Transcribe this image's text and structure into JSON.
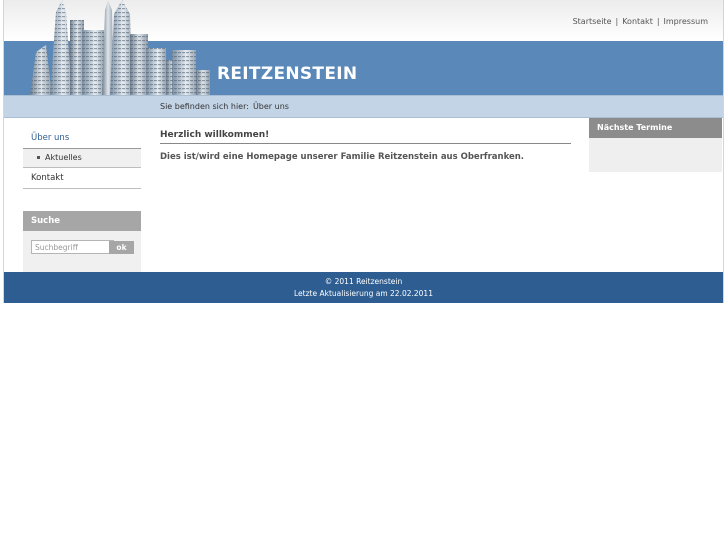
{
  "header": {
    "links": [
      "Startseite",
      "Kontakt",
      "Impressum"
    ],
    "separator": "|",
    "site_title": "REITZENSTEIN"
  },
  "breadcrumb": {
    "label": "Sie befinden sich hier:",
    "current": "Über uns"
  },
  "sidebar": {
    "items": [
      {
        "label": "Über uns"
      },
      {
        "label": "Aktuelles"
      },
      {
        "label": "Kontakt"
      }
    ]
  },
  "search": {
    "title": "Suche",
    "placeholder": "Suchbegriff",
    "button": "ok"
  },
  "main": {
    "title": "Herzlich willkommen!",
    "text": "Dies ist/wird eine Homepage unserer Familie Reitzenstein aus Oberfranken."
  },
  "termine": {
    "title": "Nächste Termine"
  },
  "footer": {
    "copyright": "© 2011 Reitzenstein",
    "updated": "Letzte Aktualisierung am 22.02.2011"
  },
  "colors": {
    "banner": "#5a88b8",
    "footer": "#2d5d91",
    "breadcrumb_bar": "#c3d4e6"
  }
}
